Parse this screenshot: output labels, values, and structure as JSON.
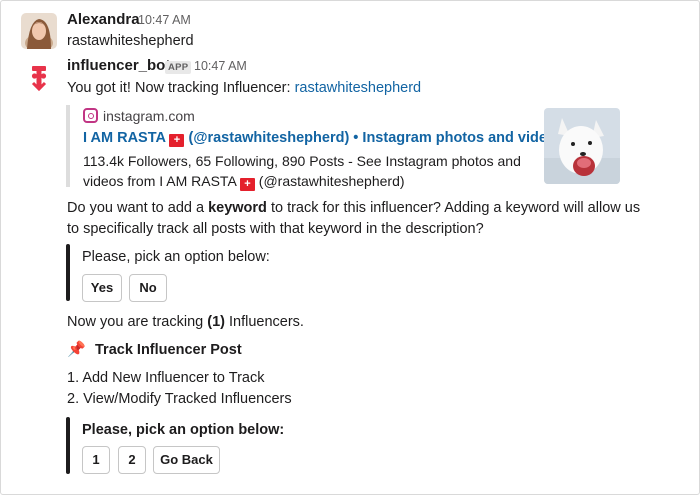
{
  "messages": {
    "user_msg": {
      "author": "Alexandra",
      "time": "10:47 AM",
      "text": "rastawhiteshepherd"
    },
    "bot_msg": {
      "author": "influencer_bot",
      "badge": "APP",
      "time": "10:47 AM",
      "intro_text": "You got it! Now tracking Influencer: ",
      "intro_link": "rastawhiteshepherd",
      "unfurl": {
        "site": "instagram.com",
        "title_pre": "I AM RASTA ",
        "title_post": " (@rastawhiteshepherd) • Instagram photos and videos",
        "desc_line1": "113.4k Followers, 65 Following, 890 Posts - See Instagram photos and",
        "desc_line2_pre": "videos from I AM RASTA ",
        "desc_line2_post": " (@rastawhiteshepherd)",
        "flag_glyph": "+",
        "image_alt": "white shepherd dog"
      },
      "question_line1_pre": "Do you want to add a ",
      "question_keyword": "keyword",
      "question_line1_post": " to track for this influencer?  Adding a keyword will allow us",
      "question_line2": "to specifically track all posts with that keyword in the description?",
      "block1": {
        "prompt": "Please, pick an option below:",
        "buttons": [
          "Yes",
          "No"
        ]
      },
      "tracking_pre": "Now you are tracking ",
      "tracking_count": "(1)",
      "tracking_post": " Influencers.",
      "section_icon": "📌",
      "section_title": "Track Influencer Post",
      "menu": [
        "1. Add New Influencer to Track",
        "2. View/Modify Tracked Influencers"
      ],
      "block2": {
        "prompt": "Please, pick an option below:",
        "buttons": [
          "1",
          "2",
          "Go Back"
        ]
      }
    }
  },
  "colors": {
    "link": "#1264a3",
    "instagram": "#c13584",
    "bot_logo": "#e8334a"
  }
}
